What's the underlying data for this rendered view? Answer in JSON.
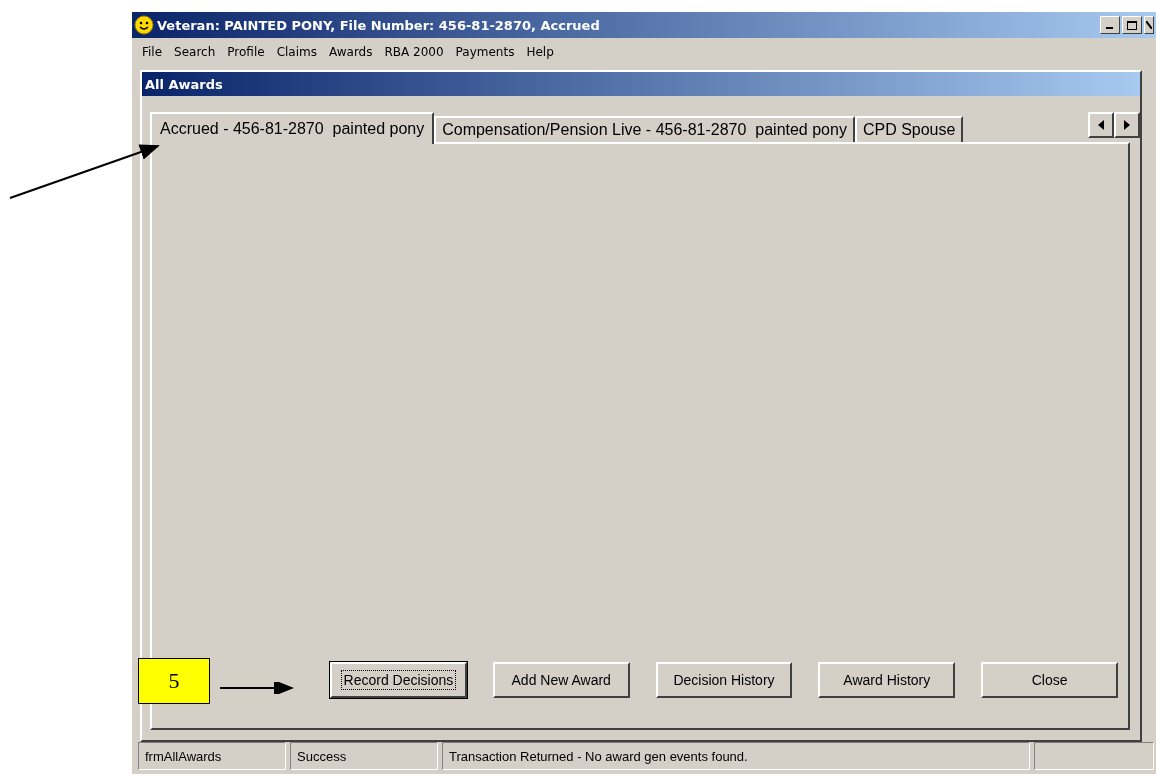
{
  "window": {
    "title": "Veteran: PAINTED PONY, File Number: 456-81-2870, Accrued"
  },
  "menu": [
    "File",
    "Search",
    "Profile",
    "Claims",
    "Awards",
    "RBA 2000",
    "Payments",
    "Help"
  ],
  "child_window": {
    "title": "All Awards"
  },
  "tabs": [
    {
      "label": "Accrued - 456-81-2870  painted pony",
      "selected": true
    },
    {
      "label": "Compensation/Pension Live - 456-81-2870  painted pony",
      "selected": false
    },
    {
      "label": "CPD Spouse",
      "selected": false
    }
  ],
  "buttons": [
    {
      "label": "Record Decisions",
      "focused": true
    },
    {
      "label": "Add New Award",
      "focused": false
    },
    {
      "label": "Decision History",
      "focused": false
    },
    {
      "label": "Award History",
      "focused": false
    },
    {
      "label": "Close",
      "focused": false
    }
  ],
  "status_bar": [
    "frmAllAwards",
    "Success",
    "Transaction Returned - No award gen events found."
  ],
  "annotation": {
    "label": "5"
  }
}
